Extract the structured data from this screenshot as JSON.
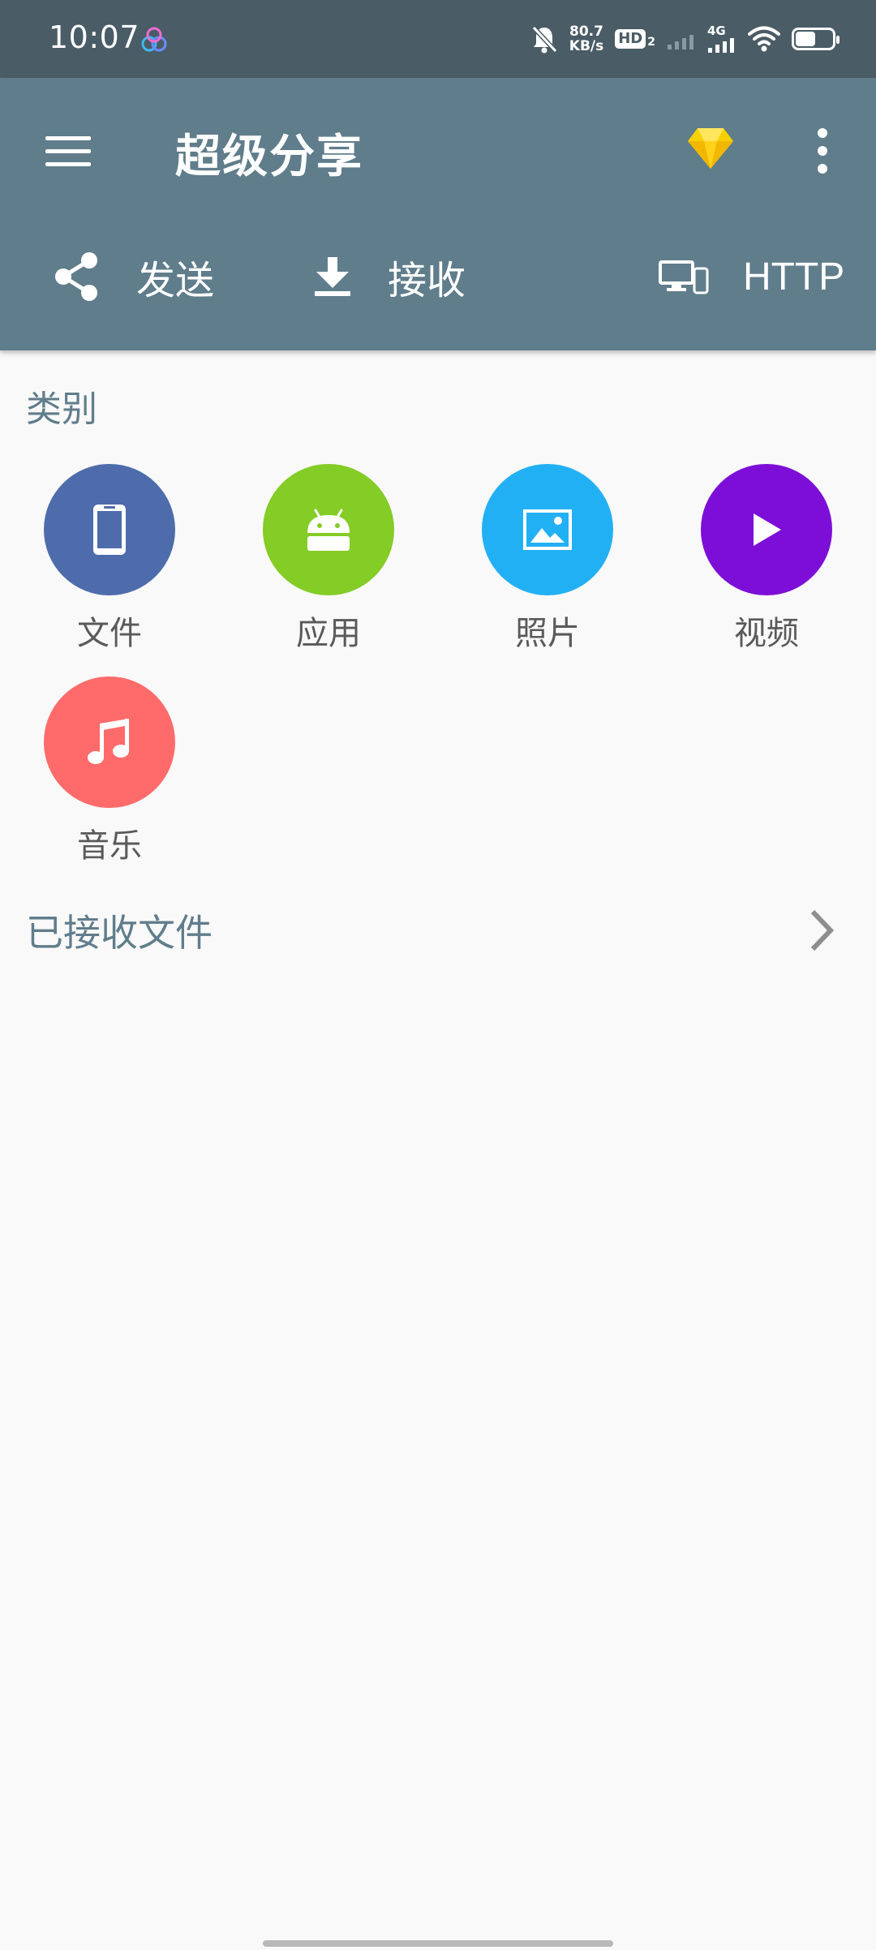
{
  "status_bar": {
    "time": "10:07",
    "net_speed_value": "80.7",
    "net_speed_unit": "KB/s",
    "hd_label": "HD",
    "hd_sub": "2",
    "signal_label": "4G",
    "battery_level": 0.55
  },
  "app_bar": {
    "title": "超级分享",
    "actions": {
      "send": "发送",
      "receive": "接收",
      "http": "HTTP"
    }
  },
  "categories": {
    "title": "类别",
    "items": [
      {
        "label": "文件",
        "color": "#4e6cab",
        "icon": "phone-icon"
      },
      {
        "label": "应用",
        "color": "#84cc26",
        "icon": "android-icon"
      },
      {
        "label": "照片",
        "color": "#22b0f5",
        "icon": "image-icon"
      },
      {
        "label": "视频",
        "color": "#7d0ed8",
        "icon": "play-icon"
      },
      {
        "label": "音乐",
        "color": "#ff6b6b",
        "icon": "music-note-icon"
      }
    ]
  },
  "received": {
    "label": "已接收文件"
  },
  "colors": {
    "status_bar": "#4a5c66",
    "app_bar": "#607d8b",
    "background": "#f9f9f9",
    "accent_text": "#607d8b",
    "premium_gem": "#f7d000"
  }
}
